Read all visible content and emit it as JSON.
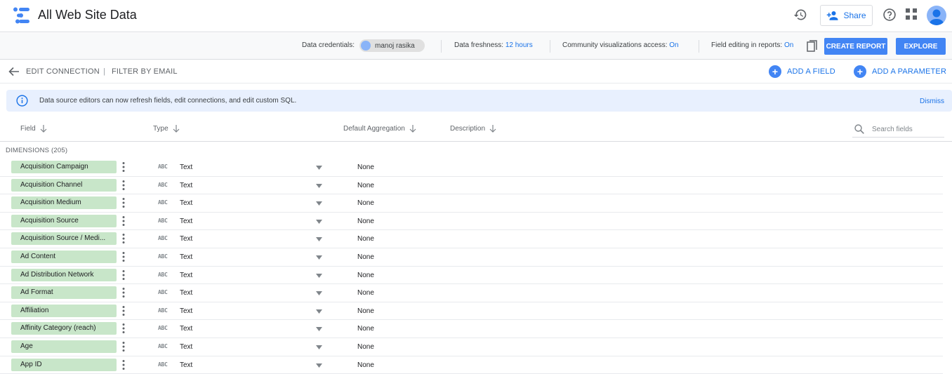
{
  "app": {
    "title": "All Web Site Data"
  },
  "header": {
    "share_label": "Share"
  },
  "infobar": {
    "credentials_label": "Data credentials:",
    "credentials_user": "manoj rasika",
    "freshness_label": "Data freshness:",
    "freshness_value": "12 hours",
    "community_label": "Community visualizations access:",
    "community_value": "On",
    "field_editing_label": "Field editing in reports:",
    "field_editing_value": "On",
    "create_report": "CREATE REPORT",
    "explore": "EXPLORE"
  },
  "toolbar": {
    "edit_connection": "EDIT CONNECTION",
    "separator": "|",
    "filter_by_email": "FILTER BY EMAIL",
    "add_field": "ADD A FIELD",
    "add_parameter": "ADD A PARAMETER"
  },
  "banner": {
    "text": "Data source editors can now refresh fields, edit connections, and edit custom SQL.",
    "dismiss": "Dismiss"
  },
  "columns": {
    "field": "Field",
    "type": "Type",
    "aggregation": "Default Aggregation",
    "description": "Description",
    "search_placeholder": "Search fields"
  },
  "section": {
    "label": "DIMENSIONS (205)"
  },
  "type_badge": "ABC",
  "rows": [
    {
      "field": "Acquisition Campaign",
      "type": "Text",
      "aggregation": "None"
    },
    {
      "field": "Acquisition Channel",
      "type": "Text",
      "aggregation": "None"
    },
    {
      "field": "Acquisition Medium",
      "type": "Text",
      "aggregation": "None"
    },
    {
      "field": "Acquisition Source",
      "type": "Text",
      "aggregation": "None"
    },
    {
      "field": "Acquisition Source / Medi...",
      "type": "Text",
      "aggregation": "None"
    },
    {
      "field": "Ad Content",
      "type": "Text",
      "aggregation": "None"
    },
    {
      "field": "Ad Distribution Network",
      "type": "Text",
      "aggregation": "None"
    },
    {
      "field": "Ad Format",
      "type": "Text",
      "aggregation": "None"
    },
    {
      "field": "Affiliation",
      "type": "Text",
      "aggregation": "None"
    },
    {
      "field": "Affinity Category (reach)",
      "type": "Text",
      "aggregation": "None"
    },
    {
      "field": "Age",
      "type": "Text",
      "aggregation": "None"
    },
    {
      "field": "App ID",
      "type": "Text",
      "aggregation": "None"
    }
  ],
  "colors": {
    "accent": "#4285f4",
    "link": "#1a73e8",
    "dimension_chip": "#c8e6c9",
    "banner_bg": "#e8f0fe"
  },
  "icons": {
    "logo": "data-studio-logo",
    "history": "history-icon",
    "share": "person-add-icon",
    "help": "help-icon",
    "apps": "apps-grid-icon",
    "copy": "copy-icon",
    "back": "arrow-back-icon",
    "info": "info-icon",
    "sort": "arrow-down-icon",
    "search": "search-icon",
    "more": "more-vert-icon",
    "dropdown": "caret-down-icon"
  }
}
